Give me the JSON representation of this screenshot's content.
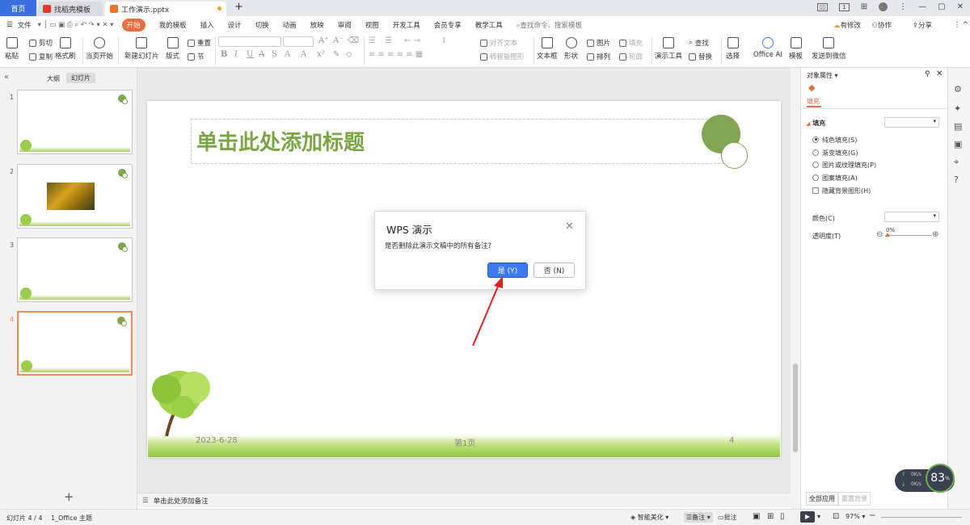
{
  "tabs": {
    "home": "首页",
    "template": "找稻壳模板",
    "doc": "工作演示.pptx",
    "new_tab": "+"
  },
  "window": {
    "badge": "1",
    "sync_label": "有修改",
    "collab": "协作",
    "share": "分享"
  },
  "menu": {
    "file": "文件",
    "items": [
      "开始",
      "我的模板",
      "插入",
      "设计",
      "切换",
      "动画",
      "放映",
      "审阅",
      "视图",
      "开发工具",
      "会员专享",
      "教学工具"
    ],
    "search_placeholder": "查找命令、搜索模板"
  },
  "ribbon": {
    "paste": "粘贴",
    "cut": "剪切",
    "copy": "复制",
    "format_painter": "格式刷",
    "from_current": "当页开始",
    "new_slide": "新建幻灯片",
    "layout": "版式",
    "section": "节",
    "reset": "重置",
    "font_size_up": "A⁺",
    "font_size_down": "A⁻",
    "bold": "B",
    "italic": "I",
    "underline": "U",
    "strike": "A",
    "shadow": "S",
    "align_text": "对齐文本",
    "smart_shape": "转智能图形",
    "textbox": "文本框",
    "shape": "形状",
    "picture": "图片",
    "fill": "填充",
    "arrange": "排列",
    "outline": "轮廓",
    "present_tools": "演示工具",
    "find": "查找",
    "replace": "替换",
    "select": "选择",
    "office_ai": "Office AI",
    "template": "模板",
    "send_wechat": "发送到微信"
  },
  "left_panel": {
    "outline_tab": "大纲",
    "slides_tab": "幻灯片",
    "slide_numbers": [
      "1",
      "2",
      "3",
      "4"
    ],
    "add": "+"
  },
  "slide": {
    "title": "单击此处添加标题",
    "date": "2023-6-28",
    "page": "第1页",
    "num": "4"
  },
  "notes": {
    "placeholder": "单击此处添加备注"
  },
  "dialog": {
    "title": "WPS 演示",
    "message": "是否删除此演示文稿中的所有备注?",
    "yes": "是 (Y)",
    "no": "否 (N)",
    "close": "✕"
  },
  "right_panel": {
    "header": "对象属性",
    "fill_tab": "填充",
    "fill_section": "填充",
    "options": [
      "纯色填充(S)",
      "渐变填充(G)",
      "图片或纹理填充(P)",
      "图案填充(A)"
    ],
    "hide_bg": "隐藏背景图形(H)",
    "color": "颜色(C)",
    "transparency": "透明度(T)",
    "transparency_value": "0%",
    "apply_all": "全部应用",
    "reset_bg": "重置背景"
  },
  "status": {
    "slide_count": "幻灯片 4 / 4",
    "theme": "1_Office 主题",
    "beautify": "智能美化",
    "notes": "备注",
    "comments": "批注",
    "zoom": "97%"
  },
  "net_widget": {
    "percent": "83",
    "unit": "%",
    "up": "0K/s",
    "down": "0K/s"
  }
}
